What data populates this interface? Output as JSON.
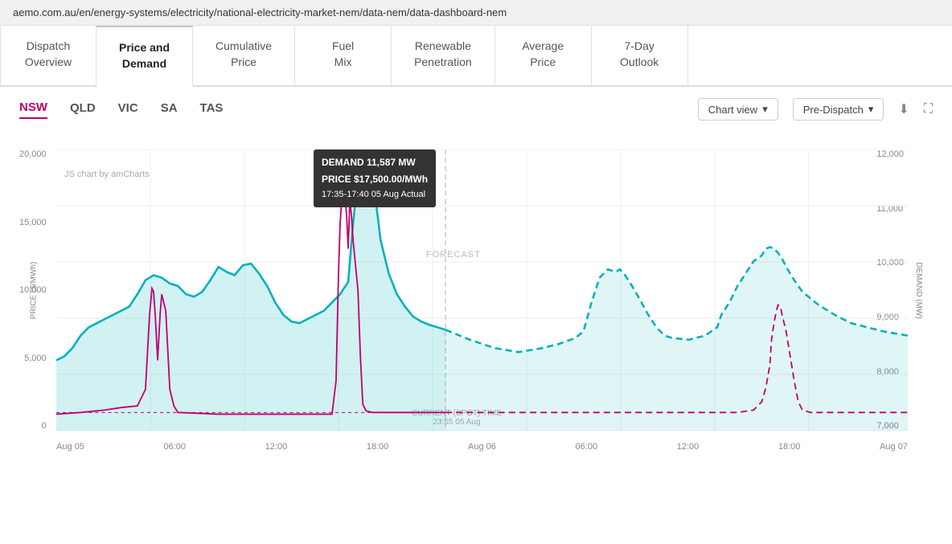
{
  "addressBar": {
    "url": "aemo.com.au/en/energy-systems/electricity/national-electricity-market-nem/data-nem/data-dashboard-nem"
  },
  "nav": {
    "tabs": [
      {
        "id": "dispatch-overview",
        "label": "Dispatch\nOverview",
        "active": false
      },
      {
        "id": "price-and-demand",
        "label": "Price and\nDemand",
        "active": true
      },
      {
        "id": "cumulative-price",
        "label": "Cumulative\nPrice",
        "active": false
      },
      {
        "id": "fuel-mix",
        "label": "Fuel\nMix",
        "active": false
      },
      {
        "id": "renewable-penetration",
        "label": "Renewable\nPenetration",
        "active": false
      },
      {
        "id": "average-price",
        "label": "Average\nPrice",
        "active": false
      },
      {
        "id": "7-day-outlook",
        "label": "7-Day\nOutlook",
        "active": false
      }
    ]
  },
  "regions": {
    "buttons": [
      {
        "id": "nsw",
        "label": "NSW",
        "active": true
      },
      {
        "id": "qld",
        "label": "QLD",
        "active": false
      },
      {
        "id": "vic",
        "label": "VIC",
        "active": false
      },
      {
        "id": "sa",
        "label": "SA",
        "active": false
      },
      {
        "id": "tas",
        "label": "TAS",
        "active": false
      }
    ]
  },
  "controls": {
    "chartView": "Chart view",
    "preDispatch": "Pre-Dispatch",
    "downloadIcon": "⬇",
    "expandIcon": "⛶"
  },
  "tooltip": {
    "demand": "DEMAND 11,587 MW",
    "price": "PRICE $17,500.00/MWh",
    "time": "17:35-17:40 05 Aug Actual"
  },
  "chart": {
    "watermark": "JS chart by amCharts",
    "forecastLabel": "FORECAST",
    "currentTimeLabel": "CURRENT (SPOT) TIME\n23:55 05 Aug",
    "yAxisLeft": [
      "20,000",
      "15,000",
      "10,000",
      "5,000",
      "0"
    ],
    "yAxisRight": [
      "12,000",
      "11,000",
      "10,000",
      "9,000",
      "8,000",
      "7,000"
    ],
    "yLabelLeft": "PRICE ($/MWh)",
    "yLabelRight": "DEMAND (MW)",
    "xAxis": [
      "Aug 05",
      "06:00",
      "12:00",
      "18:00",
      "Aug 06",
      "06:00",
      "12:00",
      "18:00",
      "Aug 07"
    ]
  },
  "colors": {
    "teal": "#00b0b9",
    "pink": "#c0006e",
    "tealFill": "rgba(0,176,185,0.18)",
    "forecastDash": "#00b0b9",
    "pinkDash": "#c0006e",
    "accent": "#c0006e"
  }
}
